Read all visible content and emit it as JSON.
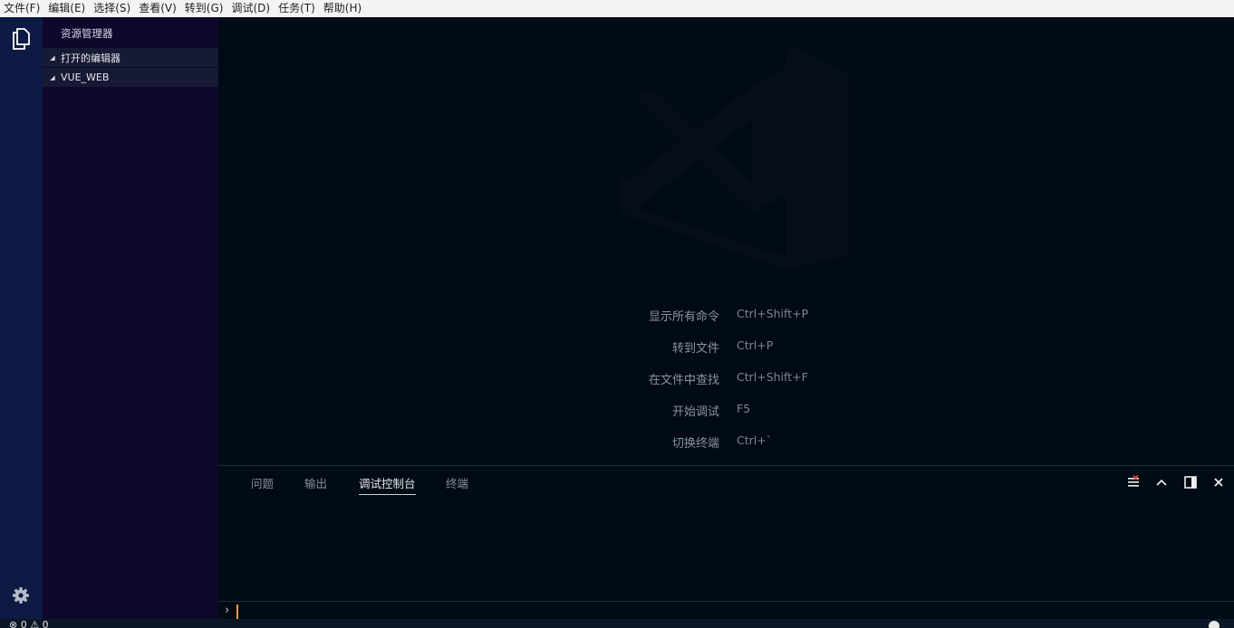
{
  "menubar": {
    "items": [
      "文件(F)",
      "编辑(E)",
      "选择(S)",
      "查看(V)",
      "转到(G)",
      "调试(D)",
      "任务(T)",
      "帮助(H)"
    ]
  },
  "activitybar": {
    "top_icon": "files-icon",
    "bottom_icon": "gear-icon"
  },
  "sidebar": {
    "title": "资源管理器",
    "sections": [
      {
        "label": "打开的编辑器"
      },
      {
        "label": "VUE_WEB"
      }
    ]
  },
  "editor": {
    "watermark_icon": "vscode-logo-icon",
    "shortcuts": [
      {
        "label": "显示所有命令",
        "key": "Ctrl+Shift+P"
      },
      {
        "label": "转到文件",
        "key": "Ctrl+P"
      },
      {
        "label": "在文件中查找",
        "key": "Ctrl+Shift+F"
      },
      {
        "label": "开始调试",
        "key": "F5"
      },
      {
        "label": "切换终端",
        "key": "Ctrl+`"
      }
    ]
  },
  "panel": {
    "tabs": [
      {
        "label": "问题",
        "active": false
      },
      {
        "label": "输出",
        "active": false
      },
      {
        "label": "调试控制台",
        "active": true
      },
      {
        "label": "终端",
        "active": false
      }
    ],
    "actions": [
      "clear-console-icon",
      "chevron-up-icon",
      "split-panel-icon",
      "close-icon"
    ],
    "prompt": "›"
  },
  "statusbar": {
    "text": "⊗ 0 ⚠ 0"
  },
  "colors": {
    "menubar_bg": "#f3f3f3",
    "activitybar_bg": "#0c1a44",
    "sidebar_bg": "#10072c",
    "editor_bg": "#000b16",
    "caret": "#e8a03c"
  }
}
